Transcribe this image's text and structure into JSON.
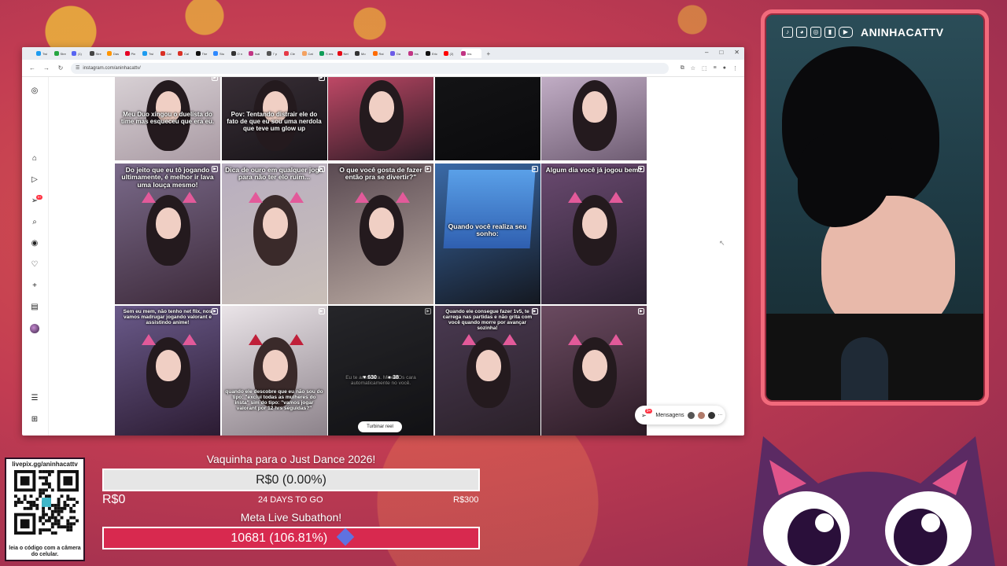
{
  "browser": {
    "tabs": [
      "Twi",
      "Stre",
      "(1)",
      "Stre",
      "Das",
      "Pin",
      "Twi",
      "Cal",
      "Cal",
      "The",
      "Stu",
      "O n",
      "Isai",
      "7 p",
      "Cle",
      "Cat",
      "S ers",
      "Net",
      "Mo",
      "Rai",
      "Da",
      "Ins",
      "Eric",
      "(2)",
      "Ins"
    ],
    "url": "instagram.com/aninhacattv/",
    "new_tab": "+",
    "window_controls": [
      "–",
      "□",
      "✕"
    ]
  },
  "sidebar": {
    "notifications_badge": "9+",
    "icons": [
      "instagram-icon",
      "home-icon",
      "reels-icon",
      "messages-icon",
      "search-icon",
      "explore-icon",
      "heart-icon",
      "create-icon",
      "dashboard-icon",
      "profile-icon",
      "menu-icon",
      "apps-icon"
    ]
  },
  "posts": [
    {
      "caption": "Meu Duo xingou o duelista do time mas esqueceu que era eu."
    },
    {
      "caption": "Pov: Tentando distrair ele do fato de que eu sou uma nerdola que teve um glow up"
    },
    {
      "caption": ""
    },
    {
      "caption": ""
    },
    {
      "caption": ""
    },
    {
      "caption": "Do jeito que eu tô jogando ultimamente, é melhor ir lava uma louça mesmo!"
    },
    {
      "caption": "Dica de ouro em qualquer jogo para não ter elo ruim..."
    },
    {
      "caption": "O que você gosta de fazer então pra se divertir?\""
    },
    {
      "caption": "Quando você realiza seu sonho:"
    },
    {
      "caption": "Algum dia você já jogou bem?"
    },
    {
      "caption": "Sem eu mem, não tenho net flix, nos vamos madrugar jogando valorant e assistindo anime!"
    },
    {
      "caption": "quando ele descobre que eu não sou do tipo: \"exclui todas as mulheres do insta\" sim do tipo: \"vamos jogar valorant por 12 hrs seguidas?\""
    },
    {
      "caption": "Eu te amo cara. Mixed Os cara automaticamente no você."
    },
    {
      "caption": "Quando ele consegue fazer 1v5, te carrega nas partidas e não grita com você quando morre por avançar sozinha!"
    },
    {
      "caption": ""
    }
  ],
  "hover_stats": {
    "likes": "630",
    "comments": "38"
  },
  "boost_button": "Turbinar reel",
  "messages": {
    "label": "Mensagens",
    "badge": "9+",
    "more": "···"
  },
  "webcam": {
    "handle": "ANINHACATTV"
  },
  "donation": {
    "qr_title": "livepix.gg/aninhacattv",
    "qr_caption": "leia o código com a câmera do celular.",
    "goal_title": "Vaquinha para o Just Dance 2026!",
    "goal_value": "R$0 (0.00%)",
    "goal_progress": 0.0,
    "goal_start": "R$0",
    "goal_days": "24 DAYS TO GO",
    "goal_target": "R$300",
    "subathon_title": "Meta Live Subathon!",
    "subathon_value": "10681 (106.81%)",
    "subathon_progress": 1.0
  },
  "colors": {
    "accent": "#f26a7c",
    "subathon_bar": "#d8294f",
    "goal_bar": "#e6e6e6",
    "badge": "#ff3040"
  }
}
